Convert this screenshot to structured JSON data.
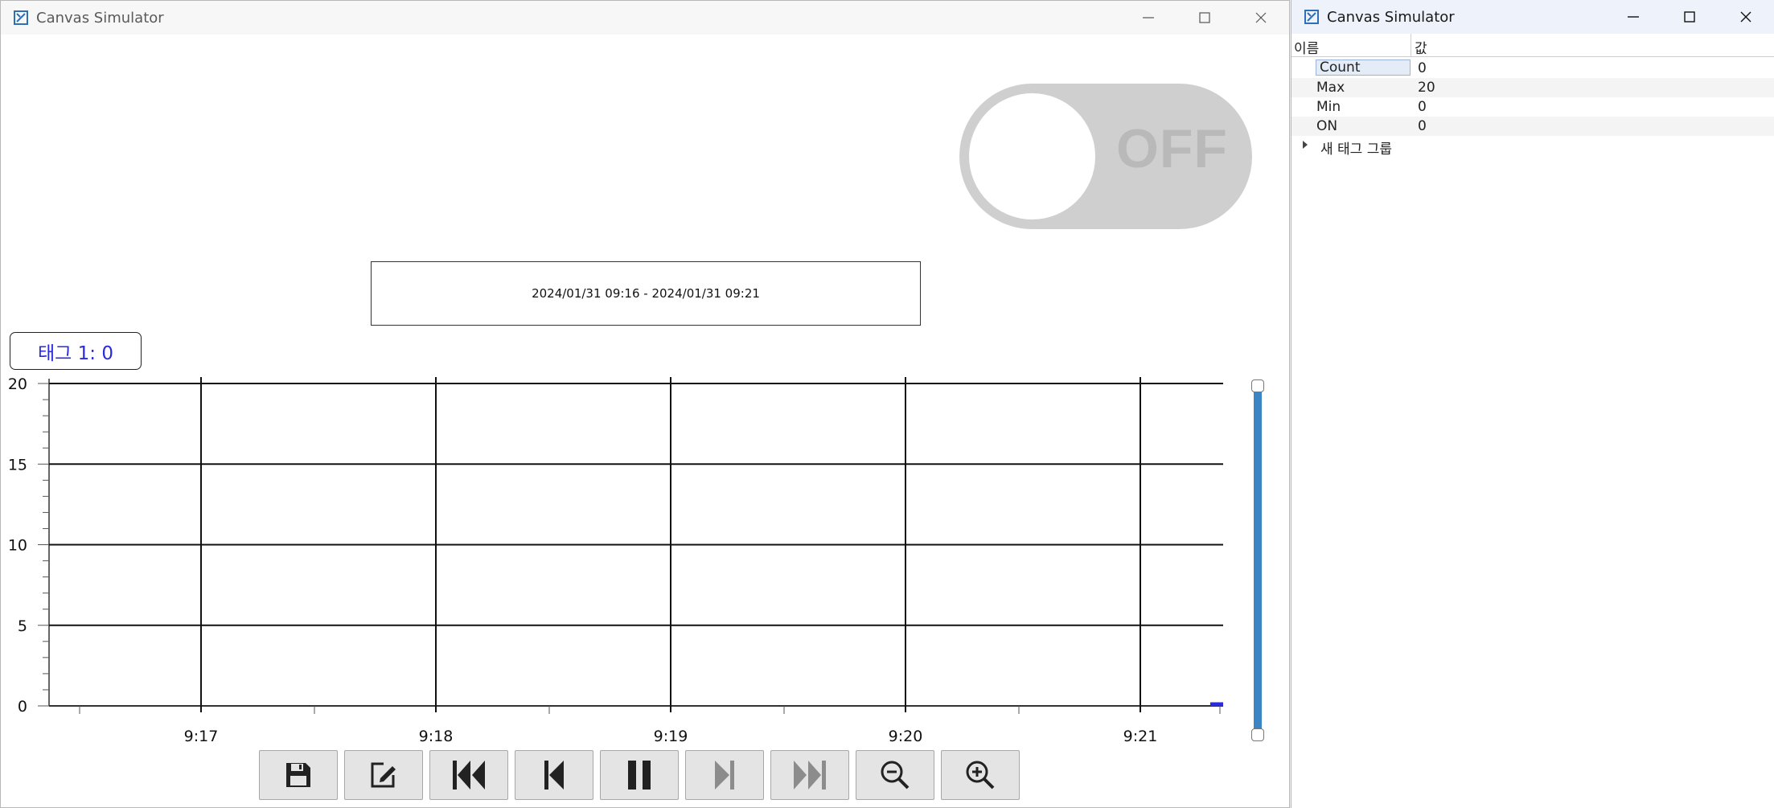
{
  "main_window": {
    "title": "Canvas Simulator",
    "toggle": {
      "state_label": "OFF"
    },
    "range_label": "2024/01/31 09:16 - 2024/01/31 09:21",
    "tag_label": "태그 1: 0",
    "toolbar": [
      {
        "name": "save-button",
        "icon": "save-icon",
        "enabled": true
      },
      {
        "name": "edit-button",
        "icon": "edit-icon",
        "enabled": true
      },
      {
        "name": "skip-to-start-button",
        "icon": "skip-start-icon",
        "enabled": true
      },
      {
        "name": "step-back-button",
        "icon": "step-back-icon",
        "enabled": true
      },
      {
        "name": "pause-button",
        "icon": "pause-icon",
        "enabled": true
      },
      {
        "name": "step-forward-button",
        "icon": "step-forward-icon",
        "enabled": false
      },
      {
        "name": "skip-to-end-button",
        "icon": "skip-end-icon",
        "enabled": false
      },
      {
        "name": "zoom-out-button",
        "icon": "zoom-out-icon",
        "enabled": true
      },
      {
        "name": "zoom-in-button",
        "icon": "zoom-in-icon",
        "enabled": true
      }
    ]
  },
  "side_window": {
    "title": "Canvas Simulator",
    "grid": {
      "headers": [
        "이름",
        "값"
      ],
      "rows": [
        {
          "name": "Count",
          "value": "0"
        },
        {
          "name": "Max",
          "value": "20"
        },
        {
          "name": "Min",
          "value": "0"
        },
        {
          "name": "ON",
          "value": "0"
        }
      ],
      "group": "새 태그 그룹"
    }
  },
  "colors": {
    "accent": "#3b85c5",
    "tag_text": "#2a2adf",
    "series": "#2a2adf",
    "toggle_bg": "#cfcfcf",
    "toggle_text": "#b9b9b9"
  },
  "chart_data": {
    "type": "line",
    "x_tick_labels": [
      "9:17",
      "9:18",
      "9:19",
      "9:20",
      "9:21"
    ],
    "y_tick_labels": [
      "0",
      "5",
      "10",
      "15",
      "20"
    ],
    "ylim": [
      0,
      20
    ],
    "grid": true,
    "series": [
      {
        "values": [
          0,
          0
        ]
      }
    ]
  }
}
